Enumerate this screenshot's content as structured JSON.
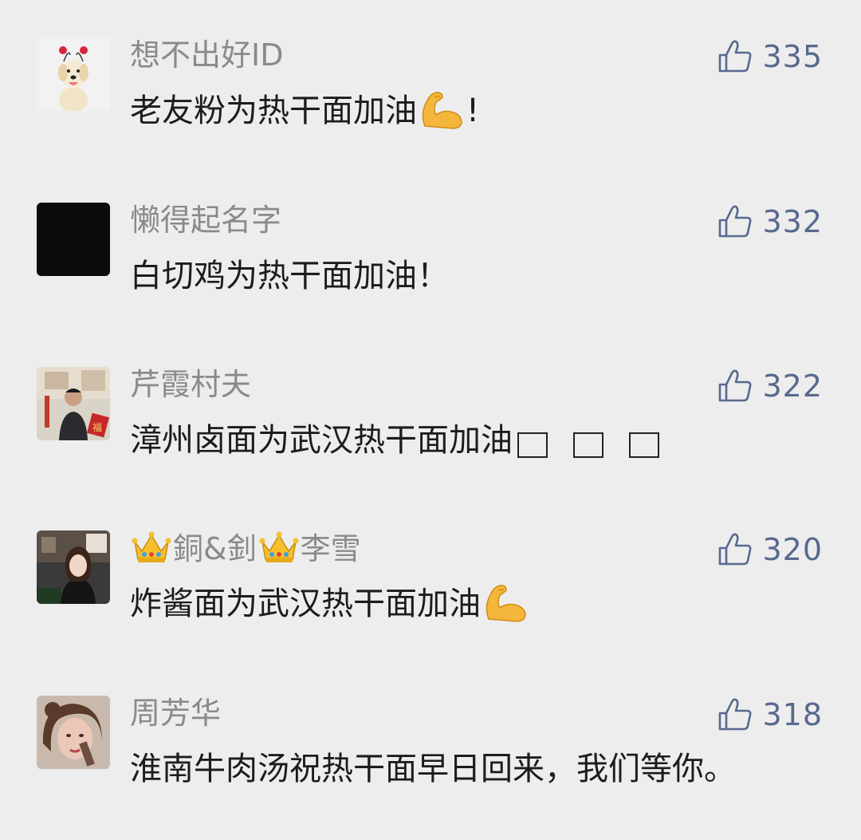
{
  "comments": [
    {
      "username": "想不出好ID",
      "likes": "335",
      "text": "老友粉为热干面加油",
      "emoji": "flexed-biceps",
      "suffix": "!"
    },
    {
      "username": "懒得起名字",
      "likes": "332",
      "text": "白切鸡为热干面加油！"
    },
    {
      "username": "芹霞村夫",
      "likes": "322",
      "text": "漳州卤面为武汉热干面加油",
      "placeholder_glyphs": 3
    },
    {
      "username_part1": "銅&釗",
      "username_part2": "李雪",
      "username_icon": "crown",
      "likes": "320",
      "text": "炸酱面为武汉热干面加油",
      "emoji": "flexed-biceps"
    },
    {
      "username": "周芳华",
      "likes": "318",
      "text": "淮南牛肉汤祝热干面早日回来，我们等你。"
    }
  ],
  "colors": {
    "background": "#ededed",
    "username": "#8a8a8a",
    "like": "#58698f",
    "text": "#1c1c1c"
  }
}
